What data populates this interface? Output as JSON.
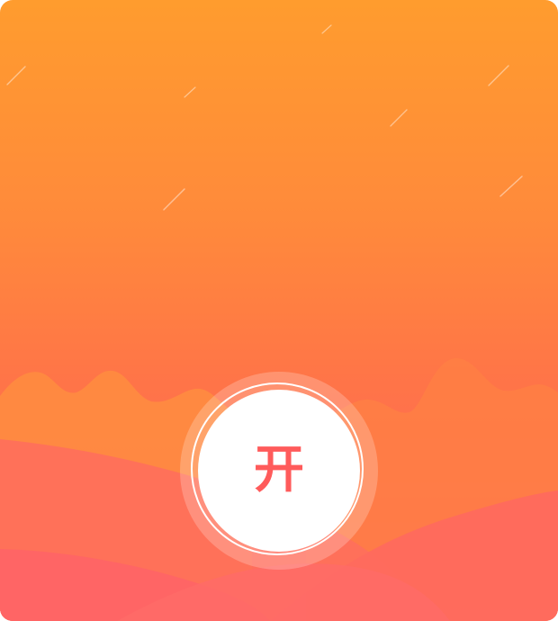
{
  "open_button": {
    "label": "开",
    "text_color": "#ff5b5b",
    "face_color": "#ffffff"
  },
  "background": {
    "gradient_top": "#ff9c2e",
    "gradient_bottom": "#ff6464",
    "decor": [
      "shooting-star-streaks",
      "mountain-silhouettes",
      "rolling-hills"
    ]
  }
}
